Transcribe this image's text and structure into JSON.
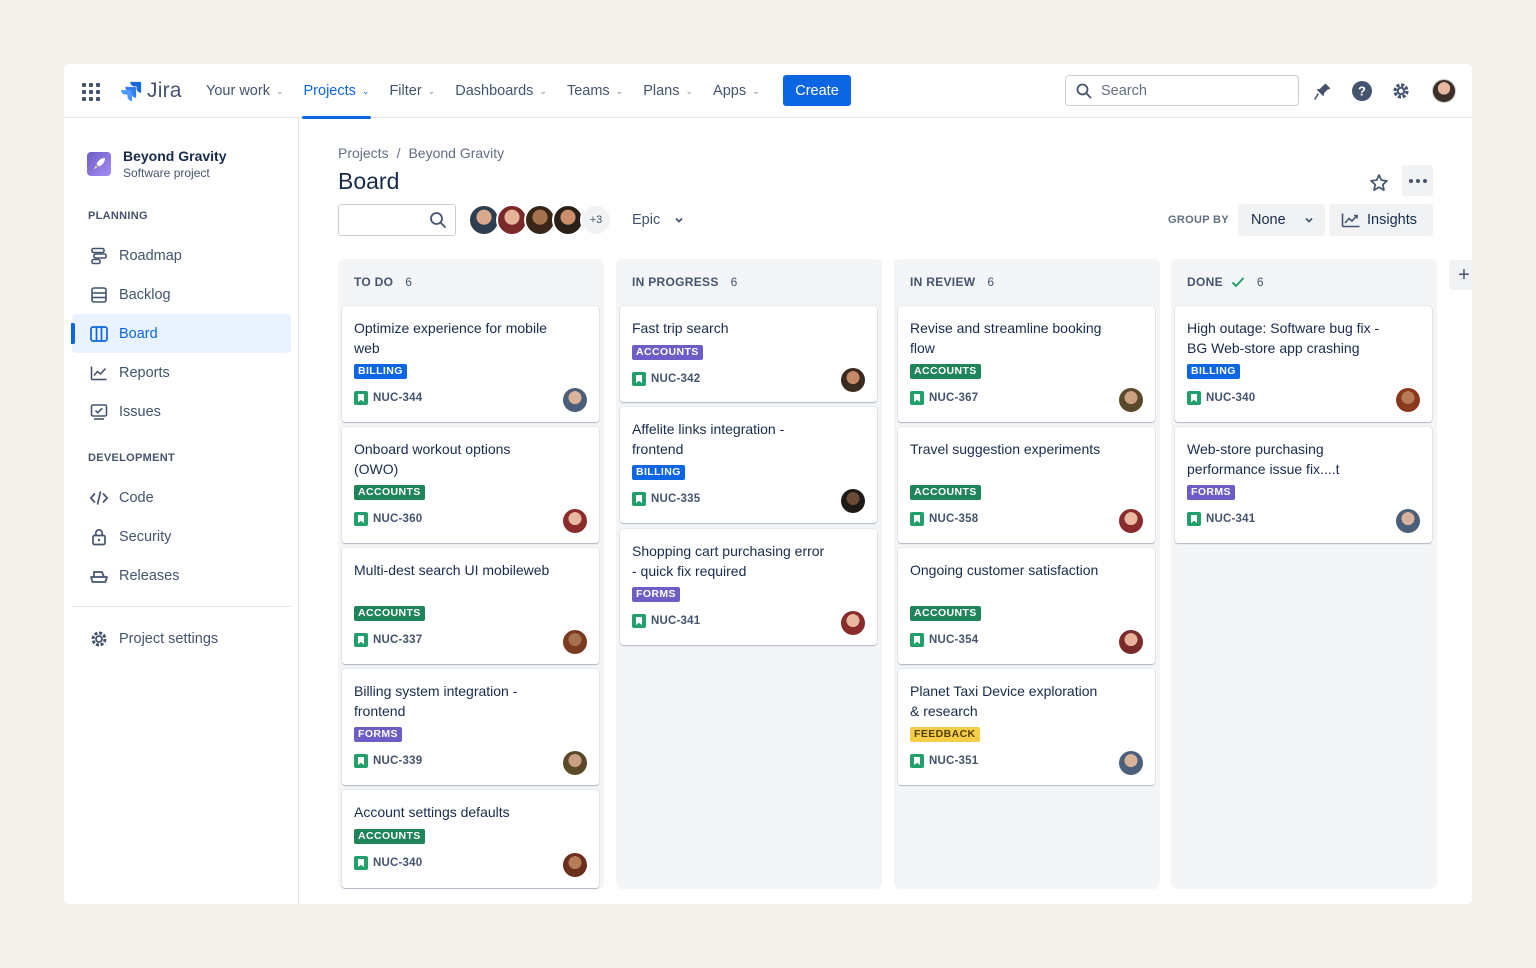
{
  "nav": {
    "logo": "Jira",
    "items": [
      {
        "label": "Your work",
        "active": false
      },
      {
        "label": "Projects",
        "active": true
      },
      {
        "label": "Filter",
        "active": false
      },
      {
        "label": "Dashboards",
        "active": false
      },
      {
        "label": "Teams",
        "active": false
      },
      {
        "label": "Plans",
        "active": false
      },
      {
        "label": "Apps",
        "active": false
      }
    ],
    "create_label": "Create",
    "search_placeholder": "Search",
    "icons": [
      "notification-icon",
      "help-icon",
      "settings-icon",
      "profile-avatar"
    ]
  },
  "sidebar": {
    "project_name": "Beyond Gravity",
    "project_type": "Software project",
    "planning_label": "PLANNING",
    "planning_items": [
      {
        "label": "Roadmap",
        "icon": "roadmap-icon"
      },
      {
        "label": "Backlog",
        "icon": "backlog-icon"
      },
      {
        "label": "Board",
        "icon": "board-icon",
        "active": true
      },
      {
        "label": "Reports",
        "icon": "reports-icon"
      },
      {
        "label": "Issues",
        "icon": "issues-icon"
      }
    ],
    "development_label": "DEVELOPMENT",
    "development_items": [
      {
        "label": "Code",
        "icon": "code-icon"
      },
      {
        "label": "Security",
        "icon": "lock-icon"
      },
      {
        "label": "Releases",
        "icon": "ship-icon"
      }
    ],
    "settings_label": "Project settings"
  },
  "main": {
    "breadcrumb": [
      "Projects",
      "Beyond Gravity"
    ],
    "breadcrumb_sep": "/",
    "title": "Board",
    "avatars_more": "+3",
    "epic_label": "Epic",
    "group_by_label": "GROUP BY",
    "group_by_value": "None",
    "insights_label": "Insights",
    "add_column": "+"
  },
  "columns": [
    {
      "name": "TO DO",
      "count": "6",
      "done": false,
      "cards": [
        {
          "title": "Optimize experience for mobile web",
          "tag": "BILLING",
          "key": "NUC-344"
        },
        {
          "title": "Onboard workout options (OWO)",
          "tag": "ACCOUNTS",
          "key": "NUC-360"
        },
        {
          "title": "Multi-dest search UI mobileweb",
          "tag": "ACCOUNTS",
          "key": "NUC-337"
        },
        {
          "title": "Billing system integration - frontend",
          "tag": "FORMS",
          "key": "NUC-339"
        },
        {
          "title": "Account settings defaults",
          "tag": "ACCOUNTS",
          "key": "NUC-340"
        }
      ]
    },
    {
      "name": "IN PROGRESS",
      "count": "6",
      "done": false,
      "cards": [
        {
          "title": "Fast trip search",
          "tag": "ACCOUNTS",
          "key": "NUC-342"
        },
        {
          "title": "Affelite links integration - frontend",
          "tag": "BILLING",
          "key": "NUC-335"
        },
        {
          "title": "Shopping cart purchasing error - quick fix required",
          "tag": "FORMS",
          "key": "NUC-341"
        }
      ]
    },
    {
      "name": "IN REVIEW",
      "count": "6",
      "done": false,
      "cards": [
        {
          "title": "Revise and streamline booking flow",
          "tag": "ACCOUNTS",
          "key": "NUC-367"
        },
        {
          "title": "Travel suggestion experiments",
          "tag": "ACCOUNTS",
          "key": "NUC-358"
        },
        {
          "title": "Ongoing customer satisfaction",
          "tag": "ACCOUNTS",
          "key": "NUC-354"
        },
        {
          "title": "Planet Taxi Device exploration & research",
          "tag": "FEEDBACK",
          "key": "NUC-351"
        }
      ]
    },
    {
      "name": "DONE",
      "count": "6",
      "done": true,
      "cards": [
        {
          "title": "High outage: Software bug fix - BG Web-store app crashing",
          "tag": "BILLING",
          "key": "NUC-340"
        },
        {
          "title": "Web-store purchasing performance issue fix....t",
          "tag": "FORMS",
          "key": "NUC-341"
        }
      ]
    }
  ],
  "colors": {
    "brand_blue": "#0c66e4",
    "accounts_green": "#1f845a",
    "forms_purple": "#6e5dc6",
    "feedback_yellow": "#f5cd47"
  }
}
